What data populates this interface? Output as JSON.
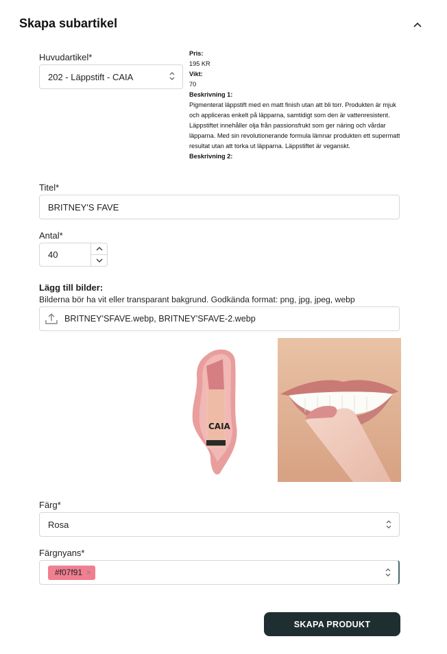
{
  "section": {
    "title": "Skapa subartikel"
  },
  "main_article": {
    "label": "Huvudartikel*",
    "value": "202 - Läppstift - CAIA"
  },
  "info": {
    "price_label": "Pris:",
    "price_value": "195 KR",
    "weight_label": "Vikt:",
    "weight_value": "70",
    "desc1_label": "Beskrivning 1:",
    "desc1_value": "Pigmenterat läppstift med en matt finish utan att bli torr. Produkten är mjuk och appliceras enkelt på läpparna, samtidigt som den är vattenresistent. Läppstiftet innehåller olja från passionsfrukt som ger näring och vårdar läpparna. Med sin revolutionerande formula lämnar produkten ett supermatt resultat utan att torka ut läpparna. Läppstiftet är veganskt.",
    "desc2_label": "Beskrivning 2:"
  },
  "title_field": {
    "label": "Titel*",
    "value": "BRITNEY'S FAVE"
  },
  "quantity": {
    "label": "Antal*",
    "value": "40"
  },
  "images": {
    "title": "Lägg till bilder:",
    "hint": "Bilderna bör ha vit eller transparant bakgrund. Godkända format: png, jpg, jpeg, webp",
    "files": "BRITNEY'SFAVE.webp, BRITNEY'SFAVE-2.webp"
  },
  "color": {
    "label": "Färg*",
    "value": "Rosa"
  },
  "shade": {
    "label": "Färgnyans*",
    "chip": "#f07f91",
    "chip_color": "#f07f91"
  },
  "submit_label": "SKAPA PRODUKT",
  "icons": [
    "chevron-up-icon",
    "select-chevrons-icon",
    "upload-icon",
    "stepper-up-icon",
    "stepper-down-icon",
    "remove-chip-icon"
  ]
}
